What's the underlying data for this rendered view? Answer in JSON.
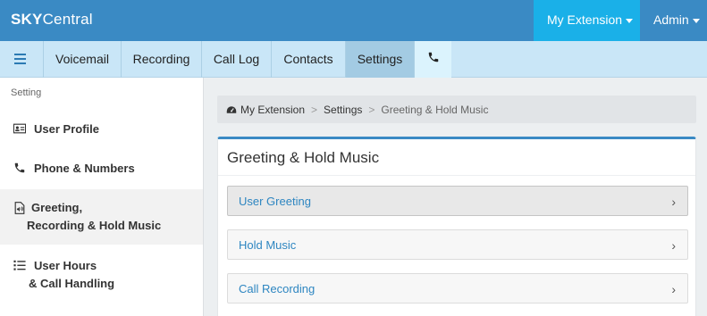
{
  "brand": {
    "part1": "SKY",
    "part2": "Central"
  },
  "top_nav": {
    "extension_label": "My Extension",
    "admin_label": "Admin"
  },
  "tabs": [
    {
      "label": "Voicemail"
    },
    {
      "label": "Recording"
    },
    {
      "label": "Call Log"
    },
    {
      "label": "Contacts"
    },
    {
      "label": "Settings",
      "active": true
    }
  ],
  "sidebar": {
    "heading": "Setting",
    "items": [
      {
        "label": "User Profile",
        "icon": "id-card-icon"
      },
      {
        "label": "Phone & Numbers",
        "icon": "phone-icon"
      },
      {
        "label_line1": "Greeting,",
        "label_line2": "Recording & Hold Music",
        "icon": "audio-file-icon",
        "active": true
      },
      {
        "label_line1": "User Hours",
        "label_line2": "& Call Handling",
        "icon": "list-icon"
      }
    ]
  },
  "breadcrumb": {
    "home": "My Extension",
    "section": "Settings",
    "current": "Greeting & Hold Music",
    "separator": ">"
  },
  "panel": {
    "title": "Greeting & Hold Music",
    "rows": [
      {
        "label": "User Greeting",
        "active": true
      },
      {
        "label": "Hold Music"
      },
      {
        "label": "Call Recording"
      }
    ]
  },
  "colors": {
    "topbar": "#3a8ac4",
    "extension_bg": "#1ab0e8",
    "tabbar": "#c9e6f7",
    "link": "#2e86c1"
  }
}
